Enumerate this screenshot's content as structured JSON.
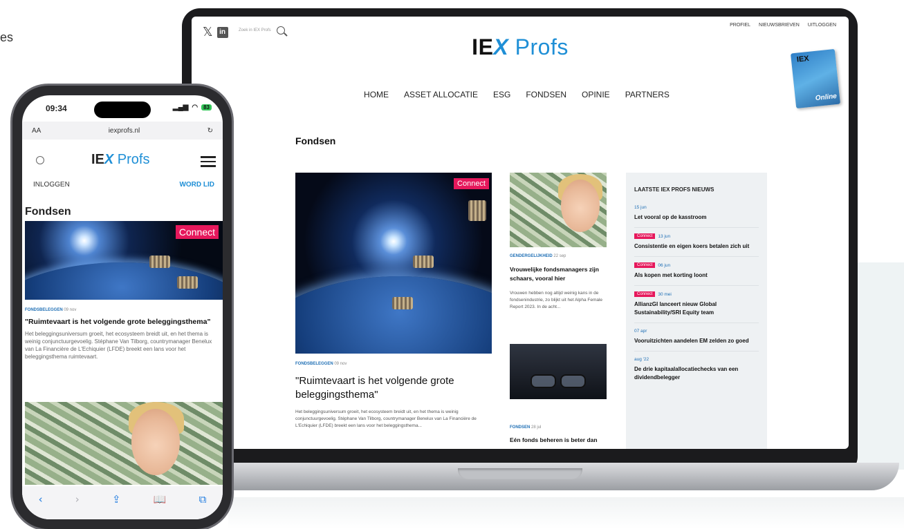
{
  "fragment_text": "es",
  "laptop": {
    "social": {
      "x": "𝕏",
      "linkedin": "in"
    },
    "search_placeholder": "Zoek in IEX Profs",
    "top_links": [
      "PROFIEL",
      "NIEUWSBRIEVEN",
      "UITLOGGEN"
    ],
    "logo": {
      "iex": "IE",
      "x": "X",
      "profs": " Profs"
    },
    "nav": [
      "HOME",
      "ASSET ALLOCATIE",
      "ESG",
      "FONDSEN",
      "OPINIE",
      "PARTNERS"
    ],
    "magazine": {
      "title": "IEX",
      "badge": "Online"
    },
    "page_title": "Fondsen",
    "hero": {
      "badge": "Connect",
      "category": "FONDSBELEGGEN",
      "date": "09 nov",
      "title": "\"Ruimtevaart is het volgende grote beleggingsthema\"",
      "summary": "Het beleggingsuniversum groeit, het ecosysteem breidt uit, en het thema is weinig conjunctuurgevoelig. Stéphane Van Tilborg, countrymanager Benelux van La Financière de L'Echiquier (LFDE) breekt een lans voor het beleggingsthema..."
    },
    "article2": {
      "category": "GENDERGELIJKHEID",
      "date": "22 sep",
      "title": "Vrouwelijke fondsmanagers zijn schaars, vooral hier",
      "summary": "Vrouwen hebben nog altijd weinig kans in de fondsenindustrie, zo blijkt uit het Alpha Female Report 2023. In de acht..."
    },
    "article3": {
      "category": "FONDSEN",
      "date": "28 jul",
      "title": "Eén fonds beheren is beter dan"
    },
    "sidebar": {
      "heading": "LAATSTE IEX PROFS NIEUWS",
      "items": [
        {
          "tag": "",
          "date": "15 jun",
          "title": "Let vooral op de kasstroom"
        },
        {
          "tag": "Connect",
          "date": "13 jun",
          "title": "Consistentie en eigen koers betalen zich uit"
        },
        {
          "tag": "Connect",
          "date": "06 jun",
          "title": "Als kopen met korting loont"
        },
        {
          "tag": "Connect",
          "date": "30 mei",
          "title": "AllianzGI lanceert nieuw Global Sustainability/SRI Equity team"
        },
        {
          "tag": "",
          "date": "07 apr",
          "title": "Vooruitzichten aandelen EM zelden zo goed"
        },
        {
          "tag": "",
          "date": "aug '22",
          "title": "De drie kapitaalallocatiechecks van een dividendbelegger"
        }
      ]
    }
  },
  "phone": {
    "time": "09:34",
    "battery": "83",
    "url_aa": "AA",
    "url": "iexprofs.nl",
    "reload": "↻",
    "logo": {
      "iex": "IE",
      "x": "X",
      "profs": " Profs"
    },
    "login": "INLOGGEN",
    "join": "WORD LID",
    "page_title": "Fondsen",
    "hero": {
      "badge": "Connect",
      "category": "FONDSBELEGGEN",
      "date": "09 nov",
      "title": "\"Ruimtevaart is het volgende grote beleggingsthema\"",
      "summary": "Het beleggingsuniversum groeit, het ecosysteem breidt uit, en het thema is weinig conjunctuurgevoelig. Stéphane Van Tilborg, countrymanager Benelux van La Financière de L'Echiquier (LFDE) breekt een lans voor het beleggingsthema ruimtevaart."
    },
    "toolbar": {
      "back": "‹",
      "forward": "›",
      "share": "⇪",
      "bookmarks": "📖",
      "tabs": "⧉"
    }
  }
}
